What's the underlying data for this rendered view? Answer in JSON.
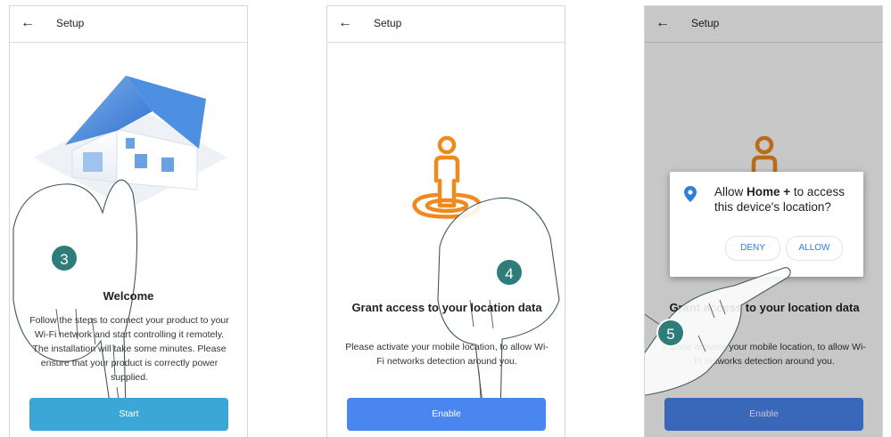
{
  "appbar": {
    "back_icon": "←",
    "title": "Setup"
  },
  "screen1": {
    "heading": "Welcome",
    "body": "Follow the steps to connect your product to your Wi-Fi network and start controlling it remotely. The installation will take some minutes. Please ensure that your product is correctly power supplied.",
    "button": "Start",
    "step": "3"
  },
  "screen2": {
    "heading": "Grant access to your location data",
    "body": "Please activate your mobile location, to allow Wi-Fi networks detection around you.",
    "button": "Enable",
    "step": "4"
  },
  "screen3": {
    "heading": "Grant access to your location data",
    "body": "Please activate your mobile location, to allow Wi-Fi networks detection around you.",
    "button": "Enable",
    "step": "5",
    "dialog": {
      "prefix": "Allow ",
      "app": "Home +",
      "suffix": " to access this device's location?",
      "deny": "DENY",
      "allow": "ALLOW"
    }
  },
  "colors": {
    "start_button": "#3aa7d6",
    "enable_button": "#4a86f0",
    "step_badge": "#2f7d7b",
    "location_icon": "#f08a1c",
    "allow_text": "#2f7fd6"
  }
}
